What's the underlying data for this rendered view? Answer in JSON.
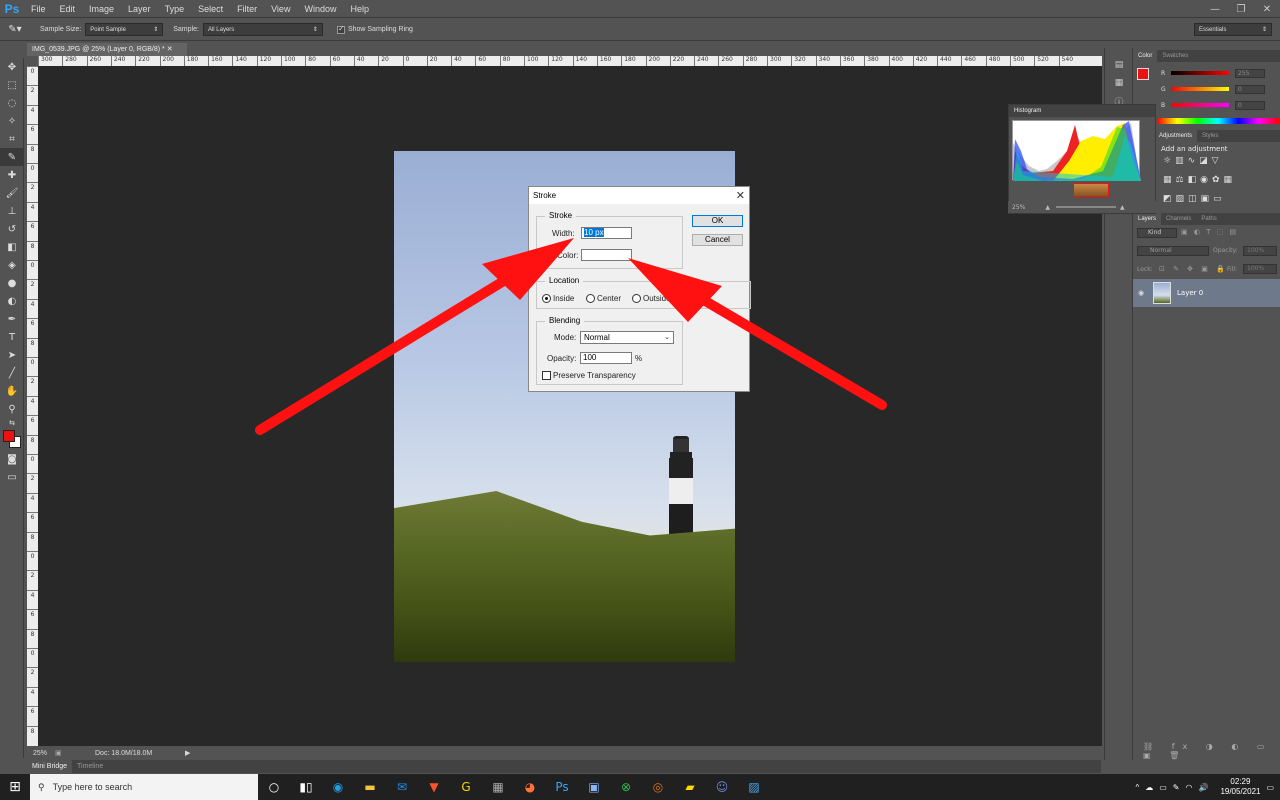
{
  "app": {
    "logo": "Ps",
    "menu": [
      "File",
      "Edit",
      "Image",
      "Layer",
      "Type",
      "Select",
      "Filter",
      "View",
      "Window",
      "Help"
    ],
    "window_controls": [
      "—",
      "❐",
      "✕"
    ]
  },
  "options": {
    "sample_size_label": "Sample Size:",
    "sample_size_value": "Point Sample",
    "sample_label": "Sample:",
    "sample_value": "All Layers",
    "show_ring_label": "Show Sampling Ring",
    "workspace": "Essentials"
  },
  "document": {
    "tab_title": "IMG_0539.JPG @ 25% (Layer 0, RGB/8) *",
    "ruler_h": [
      "300",
      "280",
      "260",
      "240",
      "220",
      "200",
      "180",
      "160",
      "140",
      "120",
      "100",
      "80",
      "60",
      "40",
      "20",
      "0",
      "20",
      "40",
      "60",
      "80",
      "100",
      "120",
      "140",
      "160",
      "180",
      "200",
      "220",
      "240",
      "260",
      "280",
      "300",
      "320",
      "340",
      "360",
      "380",
      "400",
      "420",
      "440",
      "460",
      "480",
      "500",
      "520",
      "540"
    ],
    "ruler_v": [
      "0",
      "2",
      "4",
      "6",
      "8",
      "0",
      "2",
      "4",
      "6",
      "8",
      "0",
      "2",
      "4",
      "6",
      "8",
      "0",
      "2",
      "4",
      "6",
      "8",
      "0",
      "2",
      "4",
      "6",
      "8",
      "0",
      "2",
      "4",
      "6",
      "8",
      "0",
      "2",
      "4",
      "6",
      "8"
    ]
  },
  "status": {
    "zoom": "25%",
    "doc_size": "Doc: 18.0M/18.0M"
  },
  "bottom_tabs": [
    "Mini Bridge",
    "Timeline"
  ],
  "dialog": {
    "title": "Stroke",
    "stroke_group": "Stroke",
    "width_label": "Width:",
    "width_value": "10 px",
    "color_label": "Color:",
    "ok": "OK",
    "cancel": "Cancel",
    "location_group": "Location",
    "inside": "Inside",
    "center": "Center",
    "outside": "Outside",
    "blending_group": "Blending",
    "mode_label": "Mode:",
    "mode_value": "Normal",
    "opacity_label": "Opacity:",
    "opacity_value": "100",
    "percent": "%",
    "preserve_label": "Preserve Transparency"
  },
  "panels": {
    "color_tabs": [
      "Color",
      "Swatches"
    ],
    "channels": [
      {
        "ch": "R",
        "value": "255",
        "color": "#ee1111"
      },
      {
        "ch": "G",
        "value": "0",
        "color": "#ffffff"
      },
      {
        "ch": "B",
        "value": "0",
        "color": "#ffffff"
      }
    ],
    "adjust_tabs": [
      "Adjustments",
      "Styles"
    ],
    "adjust_title": "Add an adjustment",
    "layers_tabs": [
      "Layers",
      "Channels",
      "Paths"
    ],
    "kind": "Kind",
    "blend_mode": "Normal",
    "opacity_label": "Opacity:",
    "opacity_value": "100%",
    "lock_label": "Lock:",
    "fill_label": "Fill:",
    "fill_value": "100%",
    "layer_name": "Layer 0"
  },
  "histogram": {
    "title": "Histogram",
    "zoom": "25%"
  },
  "taskbar": {
    "search_placeholder": "Type here to search",
    "time": "02:29",
    "date": "19/05/2021"
  },
  "colors": {
    "arrow": "#ff1111",
    "fg": "#ee1111",
    "bg": "#ffffff",
    "ps_blue": "#31a8ff"
  }
}
